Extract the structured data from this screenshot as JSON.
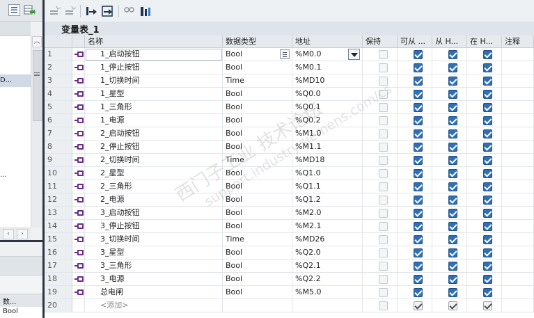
{
  "left_panel": {
    "tree_items": [
      "D...",
      "..."
    ],
    "property_header": "数...",
    "property_value": "Bool"
  },
  "table": {
    "title": "变量表_1",
    "columns": {
      "name": "名称",
      "type": "数据类型",
      "address": "地址",
      "retain": "保持",
      "accessible": "可从 ...",
      "writable": "从 H...",
      "visible": "在 H...",
      "comment": "注释"
    },
    "rows": [
      {
        "num": "1",
        "name": "1_启动按钮",
        "type": "Bool",
        "address": "%M0.0",
        "retain": false,
        "a": true,
        "b": true,
        "c": true
      },
      {
        "num": "2",
        "name": "1_停止按钮",
        "type": "Bool",
        "address": "%M0.1",
        "retain": false,
        "a": true,
        "b": true,
        "c": true
      },
      {
        "num": "3",
        "name": "1_切换时间",
        "type": "Time",
        "address": "%MD10",
        "retain": false,
        "a": true,
        "b": true,
        "c": true
      },
      {
        "num": "4",
        "name": "1_星型",
        "type": "Bool",
        "address": "%Q0.0",
        "retain": false,
        "a": true,
        "b": true,
        "c": true
      },
      {
        "num": "5",
        "name": "1_三角形",
        "type": "Bool",
        "address": "%Q0.1",
        "retain": false,
        "a": true,
        "b": true,
        "c": true
      },
      {
        "num": "6",
        "name": "1_电源",
        "type": "Bool",
        "address": "%Q0.2",
        "retain": false,
        "a": true,
        "b": true,
        "c": true
      },
      {
        "num": "7",
        "name": "2_启动按钮",
        "type": "Bool",
        "address": "%M1.0",
        "retain": false,
        "a": true,
        "b": true,
        "c": true
      },
      {
        "num": "8",
        "name": "2_停止按钮",
        "type": "Bool",
        "address": "%M1.1",
        "retain": false,
        "a": true,
        "b": true,
        "c": true
      },
      {
        "num": "9",
        "name": "2_切换时间",
        "type": "Time",
        "address": "%MD18",
        "retain": false,
        "a": true,
        "b": true,
        "c": true
      },
      {
        "num": "10",
        "name": "2_星型",
        "type": "Bool",
        "address": "%Q1.0",
        "retain": false,
        "a": true,
        "b": true,
        "c": true
      },
      {
        "num": "11",
        "name": "2_三角形",
        "type": "Bool",
        "address": "%Q1.1",
        "retain": false,
        "a": true,
        "b": true,
        "c": true
      },
      {
        "num": "12",
        "name": "2_电源",
        "type": "Bool",
        "address": "%Q1.2",
        "retain": false,
        "a": true,
        "b": true,
        "c": true
      },
      {
        "num": "13",
        "name": "3_启动按钮",
        "type": "Bool",
        "address": "%M2.0",
        "retain": false,
        "a": true,
        "b": true,
        "c": true
      },
      {
        "num": "14",
        "name": "3_停止按钮",
        "type": "Bool",
        "address": "%M2.1",
        "retain": false,
        "a": true,
        "b": true,
        "c": true
      },
      {
        "num": "15",
        "name": "3_切换时间",
        "type": "Time",
        "address": "%MD26",
        "retain": false,
        "a": true,
        "b": true,
        "c": true
      },
      {
        "num": "16",
        "name": "3_星型",
        "type": "Bool",
        "address": "%Q2.0",
        "retain": false,
        "a": true,
        "b": true,
        "c": true
      },
      {
        "num": "17",
        "name": "3_三角形",
        "type": "Bool",
        "address": "%Q2.1",
        "retain": false,
        "a": true,
        "b": true,
        "c": true
      },
      {
        "num": "18",
        "name": "3_电源",
        "type": "Bool",
        "address": "%Q2.2",
        "retain": false,
        "a": true,
        "b": true,
        "c": true
      },
      {
        "num": "19",
        "name": "总电闸",
        "type": "Bool",
        "address": "%M5.0",
        "retain": false,
        "a": true,
        "b": true,
        "c": true
      }
    ],
    "add_row": {
      "num": "20",
      "name": "<添加>"
    }
  },
  "watermark": {
    "line1": "西门子工业  技术论坛",
    "line2": "support.industry.siemens.com/cs"
  },
  "colors": {
    "checkbox_on": "#2f6fb8",
    "tag_icon": "#6b2d86"
  }
}
